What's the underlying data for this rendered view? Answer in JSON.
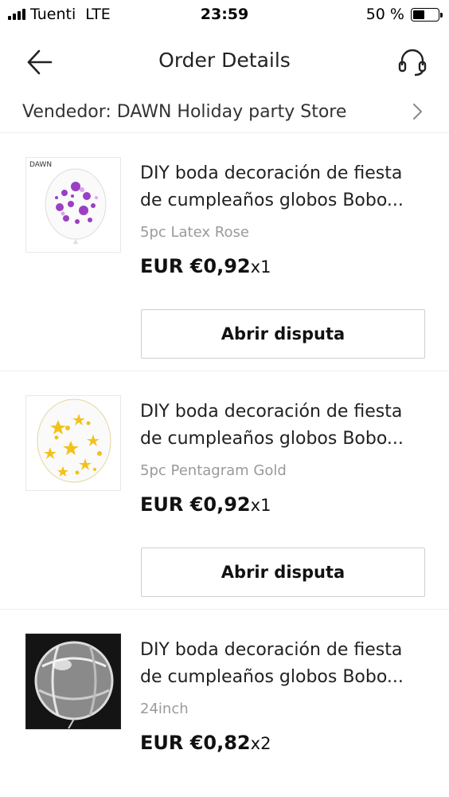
{
  "status_bar": {
    "carrier": "Tuenti",
    "network": "LTE",
    "time": "23:59",
    "battery": "50 %",
    "battery_level": 0.5
  },
  "header": {
    "title": "Order Details",
    "back_icon": "arrow-left-icon",
    "support_icon": "headset-icon"
  },
  "seller": {
    "label": "Vendedor: DAWN Holiday party Store",
    "icon": "chevron-right-icon"
  },
  "items": [
    {
      "title": "DIY boda decoración de fiesta de cumpleaños globos Bobo...",
      "variant": "5pc Latex Rose",
      "price": "EUR €0,92",
      "qty": "x1",
      "thumb_brand": "DAWN",
      "thumb_color": "#9b3fc4",
      "button": "Abrir disputa"
    },
    {
      "title": "DIY boda decoración de fiesta de cumpleaños globos Bobo...",
      "variant": "5pc Pentagram Gold",
      "price": "EUR €0,92",
      "qty": "x1",
      "thumb_color": "#f2c21a",
      "button": "Abrir disputa"
    },
    {
      "title": "DIY boda decoración de fiesta de cumpleaños globos Bobo...",
      "variant": "24inch",
      "price": "EUR €0,82",
      "qty": "x2",
      "thumb_color": "#111111"
    }
  ]
}
